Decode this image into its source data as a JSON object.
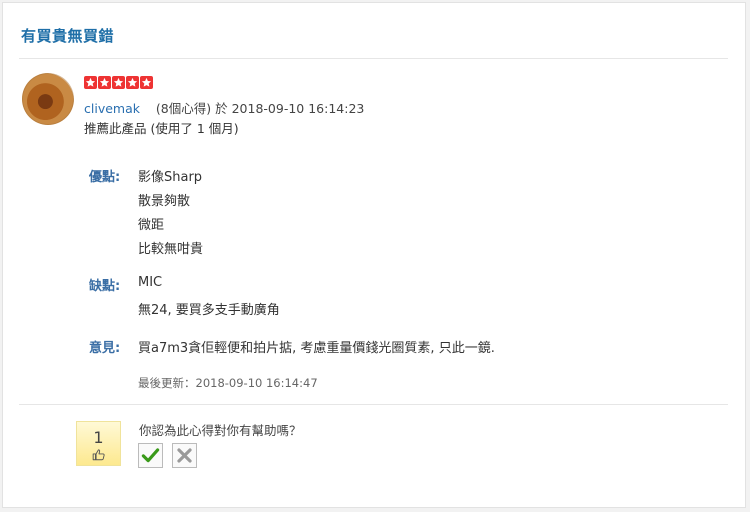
{
  "review": {
    "title": "有買貴無買錯",
    "rating": 5,
    "user": {
      "name": "clivemak",
      "posts": "(8個心得)",
      "time_prefix": "於",
      "timestamp": "2018-09-10 16:14:23"
    },
    "recommend": "推薦此產品 (使用了 1 個月)",
    "pros_label": "優點:",
    "pros": [
      "影像Sharp",
      "散景夠散",
      "微距",
      "比較無咁貴"
    ],
    "cons_label": "缺點:",
    "cons": [
      "MIC",
      "無24, 要買多支手動廣角"
    ],
    "opinion_label": "意見:",
    "opinion": "買a7m3貪佢輕便和拍片掂, 考慮重量價錢光圈質素, 只此一鏡.",
    "updated": "最後更新：2018-09-10 16:14:47"
  },
  "helpful": {
    "count": "1",
    "question": "你認為此心得對你有幫助嗎？"
  },
  "colors": {
    "title": "#1f6fa8",
    "username": "#2a6fb0",
    "label": "#3a6ea5",
    "star": "#e33333",
    "yes_check": "#3a9a1a",
    "no_cross": "#999999"
  },
  "icons": [
    "star-icon",
    "thumbs-up-icon",
    "check-icon",
    "cross-icon"
  ]
}
